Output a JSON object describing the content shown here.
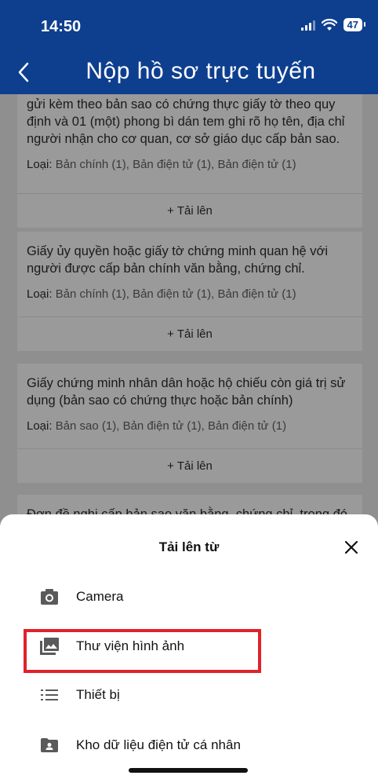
{
  "status_bar": {
    "time": "14:50",
    "battery": "47"
  },
  "header": {
    "title": "Nộp hồ sơ trực tuyến"
  },
  "cards": [
    {
      "text": "gửi kèm theo bản sao có chứng thực giấy tờ theo quy định và 01 (một) phong bì dán tem ghi rõ họ tên, địa chỉ người nhận cho cơ quan, cơ sở giáo dục cấp bản sao.",
      "type_label": "Loại:",
      "type_value": " Bản chính (1), Bản điện tử (1), Bản điện tử (1)",
      "upload_label": "+ Tải lên"
    },
    {
      "text": "Giấy ủy quyền hoặc giấy tờ chứng minh quan hệ với người được cấp bản chính văn bằng, chứng chỉ.",
      "type_label": "Loại:",
      "type_value": " Bản chính (1), Bản điện tử (1), Bản điện tử (1)",
      "upload_label": "+ Tải lên"
    },
    {
      "text": "Giấy chứng minh nhân dân hoặc hộ chiếu còn giá trị sử dụng (bản sao có chứng thực hoặc bản chính)",
      "type_label": "Loại:",
      "type_value": " Bản sao (1), Bản điện tử (1), Bản điện tử (1)",
      "upload_label": "+ Tải lên"
    },
    {
      "text": "Đơn đề nghị cấp bản sao văn bằng, chứng chỉ, trong đó"
    }
  ],
  "sheet": {
    "title": "Tải lên từ",
    "options": [
      {
        "label": "Camera",
        "icon": "camera-icon"
      },
      {
        "label": "Thư viện hình ảnh",
        "icon": "photo-library-icon"
      },
      {
        "label": "Thiết bị",
        "icon": "list-icon"
      },
      {
        "label": "Kho dữ liệu điện tử cá nhân",
        "icon": "personal-folder-icon"
      }
    ]
  },
  "colors": {
    "header": "#0e3f8f",
    "highlight": "#e0222a"
  }
}
